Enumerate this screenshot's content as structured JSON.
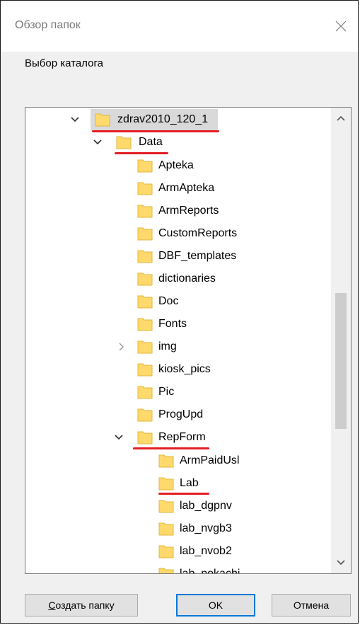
{
  "dialog": {
    "title": "Обзор папок",
    "prompt": "Выбор каталога"
  },
  "tree": {
    "root": "zdrav2010_120_1",
    "data": "Data",
    "items": [
      {
        "label": "Apteka"
      },
      {
        "label": "ArmApteka"
      },
      {
        "label": "ArmReports"
      },
      {
        "label": "CustomReports"
      },
      {
        "label": "DBF_templates"
      },
      {
        "label": "dictionaries"
      },
      {
        "label": "Doc"
      },
      {
        "label": "Fonts"
      },
      {
        "label": "img"
      },
      {
        "label": "kiosk_pics"
      },
      {
        "label": "Pic"
      },
      {
        "label": "ProgUpd"
      },
      {
        "label": "RepForm"
      }
    ],
    "repform_children": [
      {
        "label": "ArmPaidUsl"
      },
      {
        "label": "Lab"
      },
      {
        "label": "lab_dgpnv"
      },
      {
        "label": "lab_nvgb3"
      },
      {
        "label": "lab_nvob2"
      },
      {
        "label": "lab_pokachi"
      }
    ]
  },
  "buttons": {
    "create_folder_accel": "С",
    "create_folder_rest": "оздать папку",
    "ok": "OK",
    "cancel": "Отмена"
  },
  "colors": {
    "folder_fill": "#ffd96b",
    "folder_edge": "#e0b73e",
    "annotation_red": "#e31e24",
    "ok_border": "#0078d7"
  }
}
